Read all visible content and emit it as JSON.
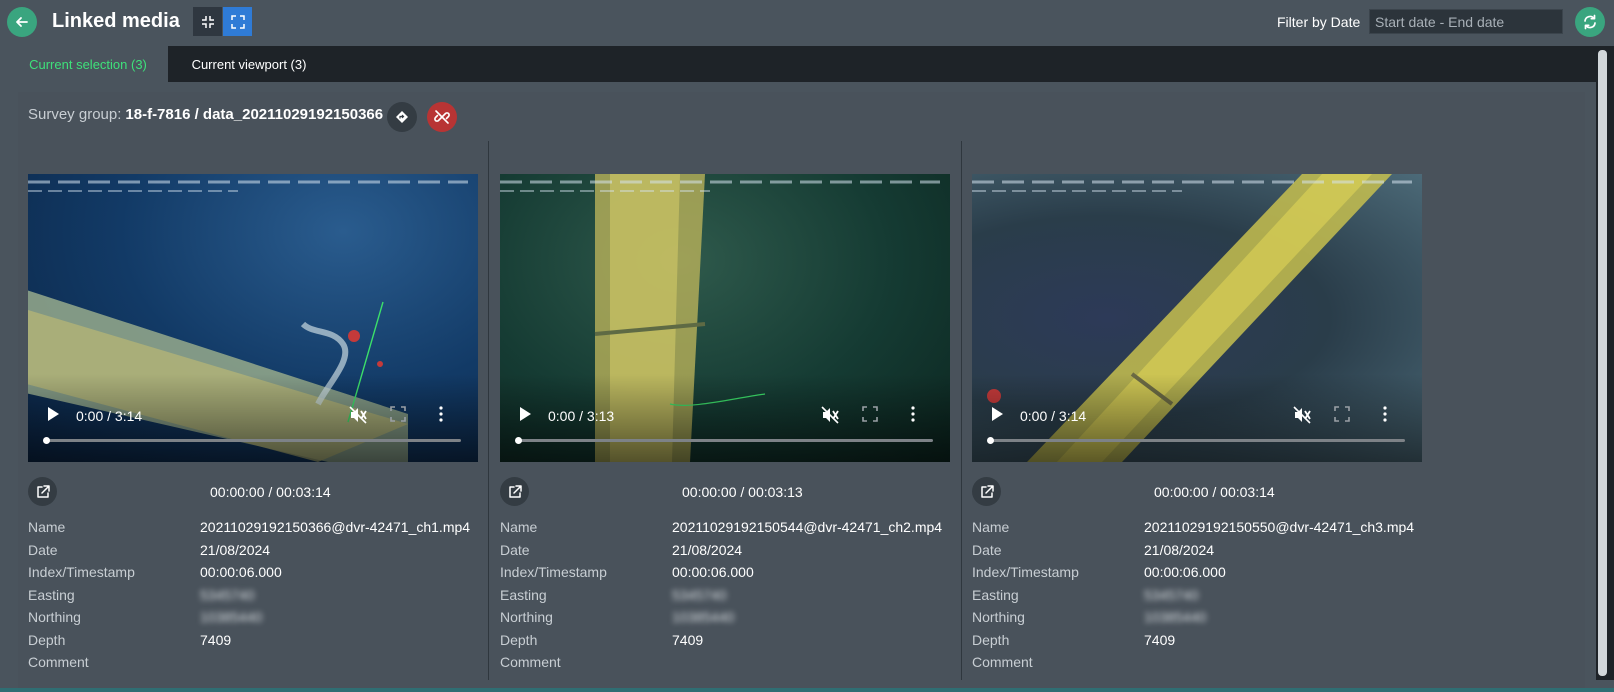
{
  "header": {
    "title": "Linked media",
    "filter_label": "Filter by Date",
    "date_placeholder": "Start date - End date"
  },
  "tabs": [
    {
      "label": "Current selection (3)",
      "active": true
    },
    {
      "label": "Current viewport (3)",
      "active": false
    }
  ],
  "survey": {
    "label": "Survey group:",
    "value": "18-f-7816 / data_20211029192150366"
  },
  "meta_labels": [
    "Name",
    "Date",
    "Index/Timestamp",
    "Easting",
    "Northing",
    "Depth",
    "Comment"
  ],
  "media": [
    {
      "video_time": "0:00 / 3:14",
      "time_readout": "00:00:00 / 00:03:14",
      "name": "20211029192150366@dvr-42471_ch1.mp4",
      "date": "21/08/2024",
      "timestamp": "00:00:06.000",
      "easting": "5345740",
      "northing": "10385440",
      "depth": "7409",
      "comment": ""
    },
    {
      "video_time": "0:00 / 3:13",
      "time_readout": "00:00:00 / 00:03:13",
      "name": "20211029192150544@dvr-42471_ch2.mp4",
      "date": "21/08/2024",
      "timestamp": "00:00:06.000",
      "easting": "5345740",
      "northing": "10385440",
      "depth": "7409",
      "comment": ""
    },
    {
      "video_time": "0:00 / 3:14",
      "time_readout": "00:00:00 / 00:03:14",
      "name": "20211029192150550@dvr-42471_ch3.mp4",
      "date": "21/08/2024",
      "timestamp": "00:00:06.000",
      "easting": "5345740",
      "northing": "10385440",
      "depth": "7409",
      "comment": ""
    }
  ],
  "colors": {
    "accent_green": "#3aa57f",
    "tab_active_text": "#3ee07a",
    "unlink_red": "#b83434",
    "expand_blue": "#2f7bd6"
  },
  "icons": [
    "back-arrow-icon",
    "collapse-icon",
    "expand-icon",
    "refresh-icon",
    "locate-icon",
    "unlink-icon",
    "play-icon",
    "mute-icon",
    "fullscreen-icon",
    "more-vertical-icon",
    "external-link-icon"
  ]
}
